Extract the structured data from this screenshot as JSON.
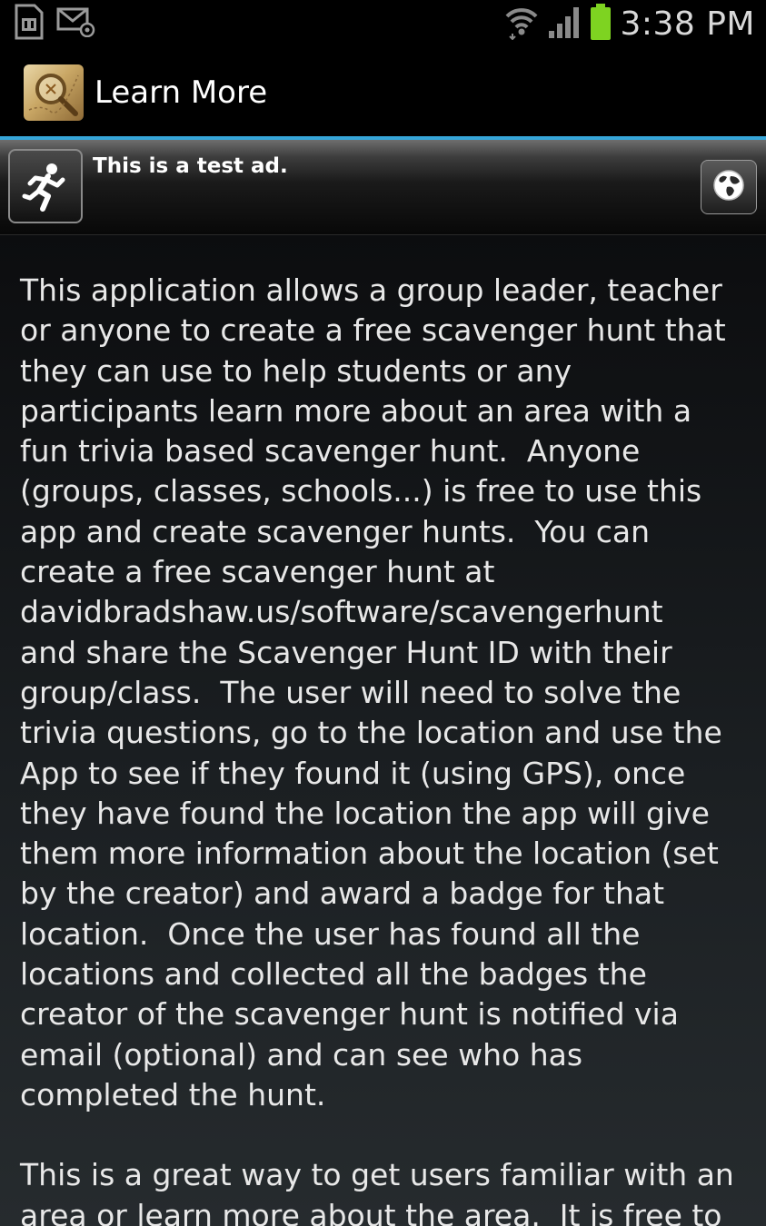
{
  "status_bar": {
    "time": "3:38 PM",
    "left_icons": [
      "sd-card-icon",
      "email-notification-icon"
    ],
    "right_icons": [
      "wifi-icon",
      "signal-icon",
      "battery-icon"
    ],
    "battery_color": "#7ed321"
  },
  "action_bar": {
    "title": "Learn More",
    "icon": "scavenger-hunt-app-icon"
  },
  "accent_color": "#36a6d9",
  "ad": {
    "text": "This is a test ad.",
    "left_icon": "running-person-icon",
    "right_icon": "globe-icon"
  },
  "content": {
    "paragraphs": [
      "This application allows a group leader, teacher\nor anyone to create a free scavenger hunt that\nthey can use to help students or any\nparticipants learn more about an area with a\nfun trivia based scavenger hunt.  Anyone\n(groups, classes, schools...) is free to use this\napp and create scavenger hunts.  You can\ncreate a free scavenger hunt at\ndavidbradshaw.us/software/scavengerhunt\nand share the Scavenger Hunt ID with their\ngroup/class.  The user will need to solve the\ntrivia questions, go to the location and use the\nApp to see if they found it (using GPS), once\nthey have found the location the app will give\nthem more information about the location (set\nby the creator) and award a badge for that\nlocation.  Once the user has found all the\nlocations and collected all the badges the\ncreator of the scavenger hunt is notified via\nemail (optional) and can see who has\ncompleted the hunt.",
      "This is a great way to get users familiar with an\narea or learn more about the area.  It is free to"
    ]
  }
}
